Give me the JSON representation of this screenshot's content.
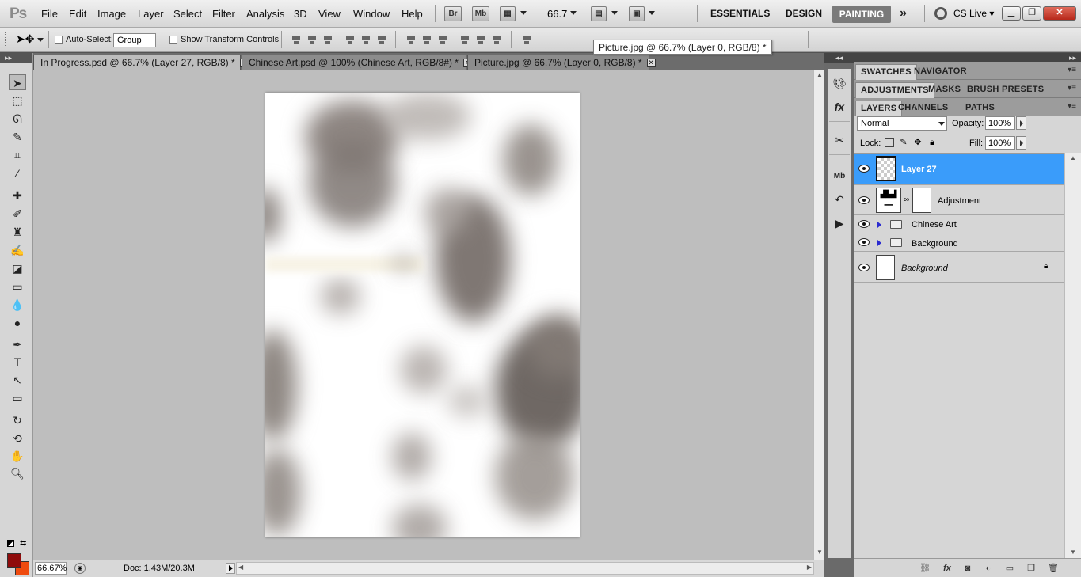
{
  "app": {
    "logo": "Ps",
    "menu": [
      "File",
      "Edit",
      "Image",
      "Layer",
      "Select",
      "Filter",
      "Analysis",
      "3D",
      "View",
      "Window",
      "Help"
    ],
    "bridge_label": "Br",
    "minibridge_label": "Mb",
    "zoom": "66.7",
    "workspaces": {
      "essentials": "ESSENTIALS",
      "design": "DESIGN",
      "painting": "PAINTING",
      "more": "»"
    },
    "cs_live": "CS Live"
  },
  "options_bar": {
    "auto_select_label": "Auto-Select:",
    "auto_select_checked": false,
    "auto_select_mode": "Group",
    "show_transform_label": "Show Transform Controls",
    "show_transform_checked": false
  },
  "tooltip": "Picture.jpg @ 66.7% (Layer 0, RGB/8) *",
  "doc_tabs": [
    {
      "label": "In Progress.psd @ 66.7% (Layer 27, RGB/8) *",
      "active": true
    },
    {
      "label": "Chinese Art.psd @ 100% (Chinese Art, RGB/8#) *",
      "active": false
    },
    {
      "label": "Picture.jpg @ 66.7% (Layer 0, RGB/8) *",
      "active": false
    }
  ],
  "tools": [
    "move-tool",
    "marquee-tool",
    "lasso-tool",
    "quick-selection-tool",
    "crop-tool",
    "eyedropper-tool",
    "healing-brush-tool",
    "brush-tool",
    "clone-stamp-tool",
    "history-brush-tool",
    "eraser-tool",
    "gradient-tool",
    "blur-tool",
    "dodge-tool",
    "pen-tool",
    "type-tool",
    "path-selection-tool",
    "rectangle-tool",
    "3d-rotate-tool",
    "3d-orbit-tool",
    "hand-tool",
    "zoom-tool"
  ],
  "colors": {
    "foreground": "#8f0c0c",
    "background": "#ef4b0f",
    "selection": "#3a9cfa"
  },
  "status": {
    "zoom": "66.67%",
    "doc": "Doc: 1.43M/20.3M"
  },
  "panels": {
    "group1": [
      "SWATCHES",
      "NAVIGATOR"
    ],
    "group2": [
      "ADJUSTMENTS",
      "MASKS",
      "BRUSH PRESETS"
    ],
    "group3": [
      "LAYERS",
      "CHANNELS",
      "PATHS"
    ],
    "blend_mode": "Normal",
    "opacity_label": "Opacity:",
    "opacity": "100%",
    "lock_label": "Lock:",
    "fill_label": "Fill:",
    "fill": "100%"
  },
  "layers": [
    {
      "name": "Layer 27",
      "selected": true,
      "kind": "pixel"
    },
    {
      "name": "Adjustment",
      "selected": false,
      "kind": "adjustment"
    },
    {
      "name": "Chinese Art",
      "selected": false,
      "kind": "group"
    },
    {
      "name": "Background",
      "selected": false,
      "kind": "group"
    },
    {
      "name": "Background",
      "selected": false,
      "kind": "background",
      "locked": true
    }
  ]
}
